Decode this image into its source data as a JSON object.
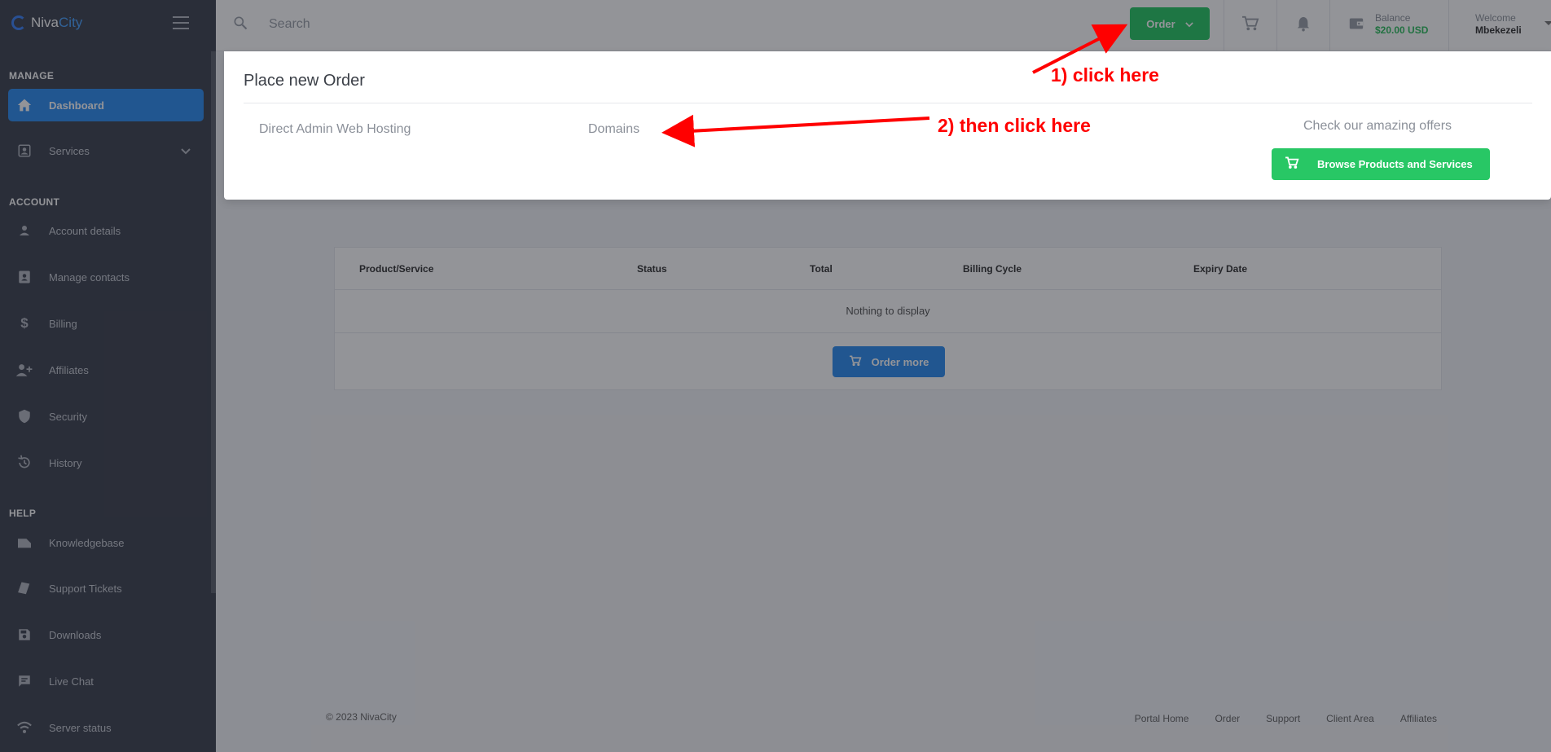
{
  "brand": {
    "name_part1": "Niva",
    "name_part2": "City"
  },
  "sidebar": {
    "sections": {
      "manage": "MANAGE",
      "account": "ACCOUNT",
      "help": "HELP"
    },
    "items": [
      {
        "label": "Dashboard",
        "icon": "home-icon"
      },
      {
        "label": "Services",
        "icon": "services-icon"
      },
      {
        "label": "Account details",
        "icon": "user-icon"
      },
      {
        "label": "Manage contacts",
        "icon": "contacts-icon"
      },
      {
        "label": "Billing",
        "icon": "dollar-icon"
      },
      {
        "label": "Affiliates",
        "icon": "affiliates-icon"
      },
      {
        "label": "Security",
        "icon": "shield-icon"
      },
      {
        "label": "History",
        "icon": "history-icon"
      },
      {
        "label": "Knowledgebase",
        "icon": "book-icon"
      },
      {
        "label": "Support Tickets",
        "icon": "ticket-icon"
      },
      {
        "label": "Downloads",
        "icon": "save-icon"
      },
      {
        "label": "Live Chat",
        "icon": "chat-icon"
      },
      {
        "label": "Server status",
        "icon": "wifi-icon"
      }
    ]
  },
  "header": {
    "search_placeholder": "Search",
    "order_label": "Order",
    "balance_label": "Balance",
    "balance_value": "$20.00 USD",
    "welcome_label": "Welcome",
    "user_name": "Mbekezeli"
  },
  "dropdown": {
    "title": "Place new Order",
    "links": [
      "Direct Admin Web Hosting",
      "Domains"
    ],
    "offer_text": "Check our amazing offers",
    "browse_label": "Browse Products and Services"
  },
  "table": {
    "columns": [
      "Product/Service",
      "Status",
      "Total",
      "Billing Cycle",
      "Expiry Date"
    ],
    "empty_text": "Nothing to display",
    "order_more_label": "Order more"
  },
  "footer": {
    "copyright": "© 2023 NivaCity",
    "links": [
      "Portal Home",
      "Order",
      "Support",
      "Client Area",
      "Affiliates"
    ]
  },
  "annotations": {
    "step1": "1) click here",
    "step2": "2) then click here",
    "color": "#ff0000"
  },
  "colors": {
    "accent_blue": "#2d8cf0",
    "accent_green": "#28c765",
    "sidebar_bg": "#3e4350"
  }
}
